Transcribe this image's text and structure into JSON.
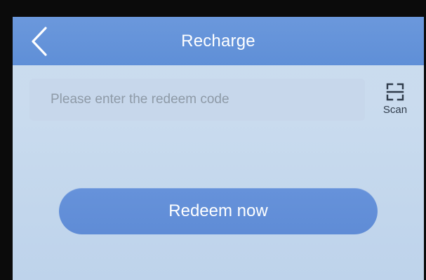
{
  "header": {
    "title": "Recharge",
    "back_icon": "chevron-left-icon"
  },
  "redeem_form": {
    "placeholder": "Please enter the redeem code",
    "value": "",
    "scan_label": "Scan",
    "scan_icon": "scan-frame-icon"
  },
  "actions": {
    "redeem_label": "Redeem now"
  },
  "colors": {
    "header_blue": "#6693d9",
    "button_blue": "#628fd8",
    "screen_bg": "#c8daee"
  }
}
